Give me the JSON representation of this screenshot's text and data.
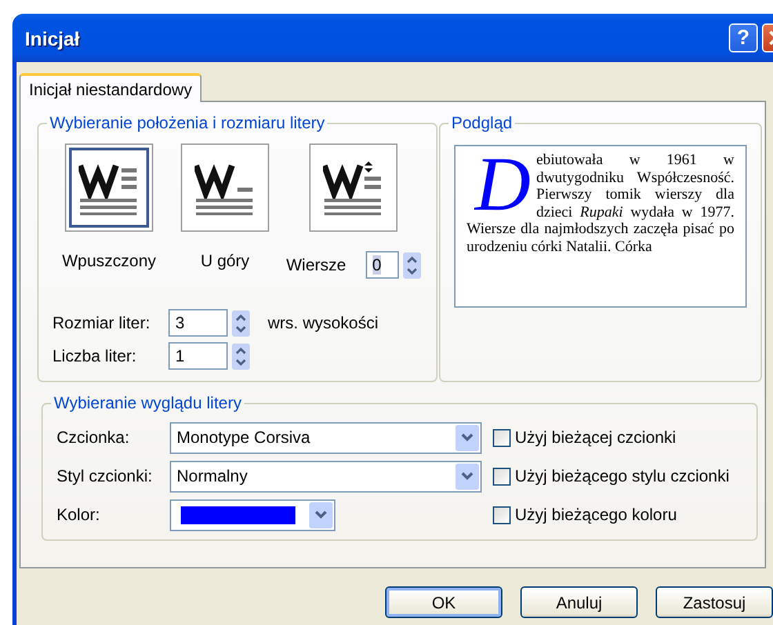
{
  "window": {
    "title": "Inicjał",
    "help_button": "?"
  },
  "tabs": [
    {
      "label": "Inicjał niestandardowy",
      "selected": true
    }
  ],
  "position_group": {
    "title": "Wybieranie położenia i rozmiaru litery",
    "options": [
      {
        "kind": "dropped",
        "label": "Wpuszczony",
        "selected": true
      },
      {
        "kind": "top",
        "label": "U góry",
        "selected": false
      },
      {
        "kind": "lines",
        "label": "Wiersze",
        "selected": false
      }
    ],
    "lines_value": "0",
    "size": {
      "label": "Rozmiar liter:",
      "value": "3",
      "unit": "wrs. wysokości"
    },
    "count": {
      "label": "Liczba liter:",
      "value": "1"
    }
  },
  "preview": {
    "title": "Podgląd",
    "drop_cap": "D",
    "text": "ebiutowała w 1961 w dwutygodniku Współczesność. Pierwszy tomik wierszy dla dzieci *Rupaki* wydała w 1977. Wiersze dla najmłodszych zaczęła pisać po urodzeniu córki Natalii. Córka"
  },
  "appearance_group": {
    "title": "Wybieranie wyglądu litery",
    "fields": [
      {
        "kind": "combo",
        "label": "Czcionka:",
        "value": "Monotype Corsiva",
        "checkbox": {
          "label": "Użyj bieżącej czcionki",
          "checked": false
        }
      },
      {
        "kind": "combo",
        "label": "Styl czcionki:",
        "value": "Normalny",
        "checkbox": {
          "label": "Użyj bieżącego stylu czcionki",
          "checked": false
        }
      },
      {
        "kind": "color",
        "label": "Kolor:",
        "color": "#0000ff",
        "checkbox": {
          "label": "Użyj bieżącego koloru",
          "checked": false
        }
      }
    ]
  },
  "buttons": [
    {
      "label": "OK",
      "default": true
    },
    {
      "label": "Anuluj",
      "default": false
    },
    {
      "label": "Zastosuj",
      "default": false
    }
  ]
}
